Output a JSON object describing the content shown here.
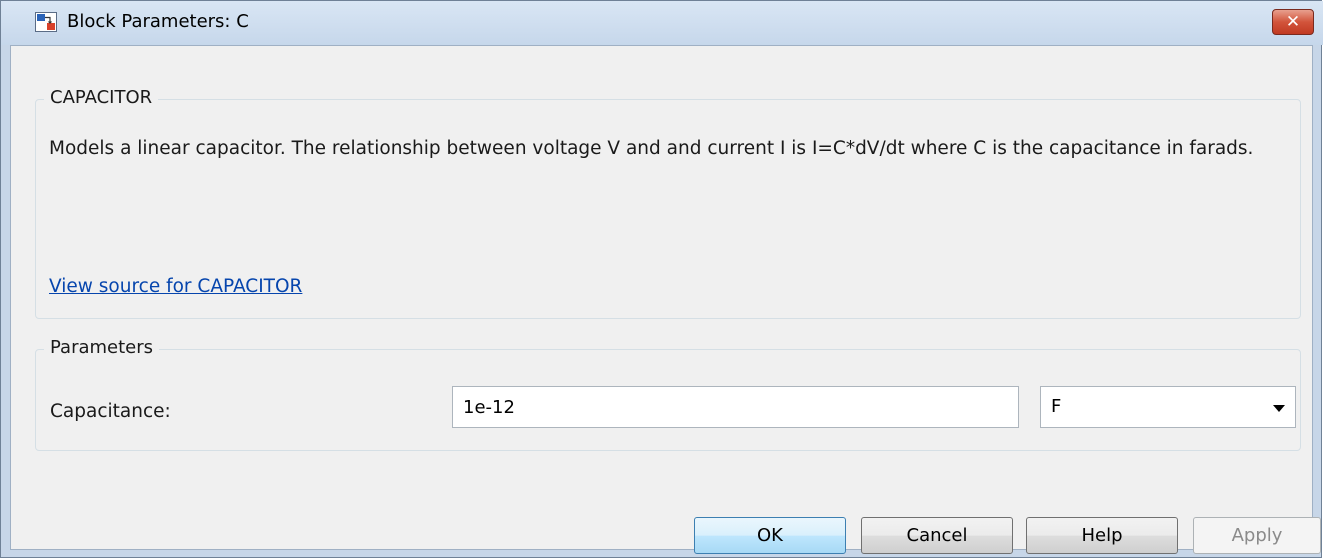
{
  "window": {
    "title": "Block Parameters: C",
    "close_symbol": "✕"
  },
  "description_group": {
    "legend": "CAPACITOR",
    "text": "Models a linear capacitor. The relationship between voltage V and and current I is I=C*dV/dt where C is the capacitance in farads.",
    "link": "View source for CAPACITOR"
  },
  "parameters_group": {
    "legend": "Parameters",
    "capacitance_label": "Capacitance:",
    "capacitance_value": "1e-12",
    "unit_value": "F"
  },
  "buttons": {
    "ok": "OK",
    "cancel": "Cancel",
    "help": "Help",
    "apply": "Apply"
  },
  "icons": {
    "title": "simulink-block-icon",
    "close": "close-icon",
    "dropdown": "chevron-down-icon"
  },
  "colors": {
    "link": "#0645ad",
    "close_button": "#c13a22",
    "ok_border": "#3c7fb1"
  }
}
